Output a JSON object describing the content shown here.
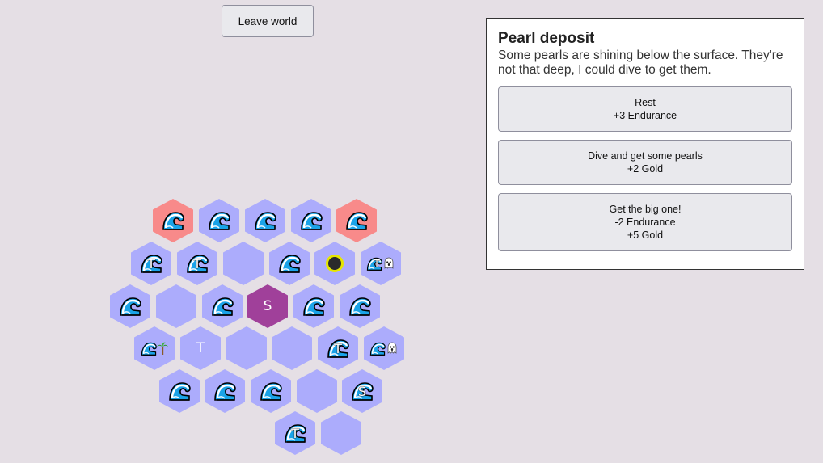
{
  "leave_button": "Leave world",
  "event": {
    "title": "Pearl deposit",
    "description": "Some pearls are shining below the surface. They're not that deep, I could dive to get them.",
    "choices": [
      {
        "lines": [
          "Rest",
          "+3 Endurance"
        ]
      },
      {
        "lines": [
          "Dive and get some pearls",
          "+2 Gold"
        ]
      },
      {
        "lines": [
          "Get the big one!",
          "-2 Endurance",
          "+5 Gold"
        ]
      }
    ]
  },
  "map": {
    "colors": {
      "water": "#acacfc",
      "danger": "#f88a8a",
      "start": "#a0409a",
      "player_ring": "#e6e600"
    },
    "start_label": "S",
    "town_label": "T",
    "secret_label": "S"
  }
}
